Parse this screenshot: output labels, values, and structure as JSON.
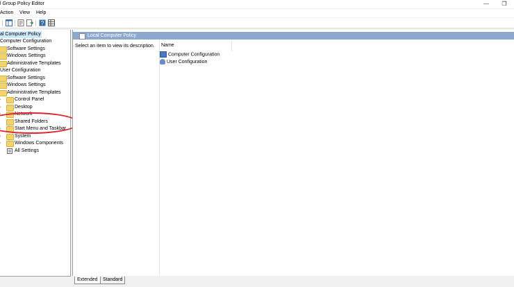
{
  "window": {
    "title": "l Group Policy Editor",
    "restore_glyph": "❐",
    "minimize_glyph": "—"
  },
  "menu": [
    "Action",
    "View",
    "Help"
  ],
  "toolbar": {
    "icons": [
      "console-tree-icon",
      "properties-icon",
      "export-icon",
      "help-icon",
      "details-view-icon"
    ]
  },
  "tree": {
    "root": "al Computer Policy",
    "computer_config": "Computer Configuration",
    "cc_children": [
      "Software Settings",
      "Windows Settings",
      "Administrative Templates"
    ],
    "user_config": "User Configuration",
    "uc_children": [
      "Software Settings",
      "Windows Settings",
      "Administrative Templates"
    ],
    "admin_children": [
      "Control Panel",
      "Desktop",
      "Network",
      "Shared Folders",
      "Start Menu and Taskbar",
      "System",
      "Windows Components",
      "All Settings"
    ]
  },
  "right": {
    "header": "Local Computer Policy",
    "description": "Select an item to view its description.",
    "column_name": "Name",
    "items": [
      "Computer Configuration",
      "User Configuration"
    ]
  },
  "tabs": [
    "Extended",
    "Standard"
  ],
  "colors": {
    "header_bg": "#8ba9cd",
    "selected_bg": "#cce8ff",
    "annotation": "#e0232a"
  }
}
